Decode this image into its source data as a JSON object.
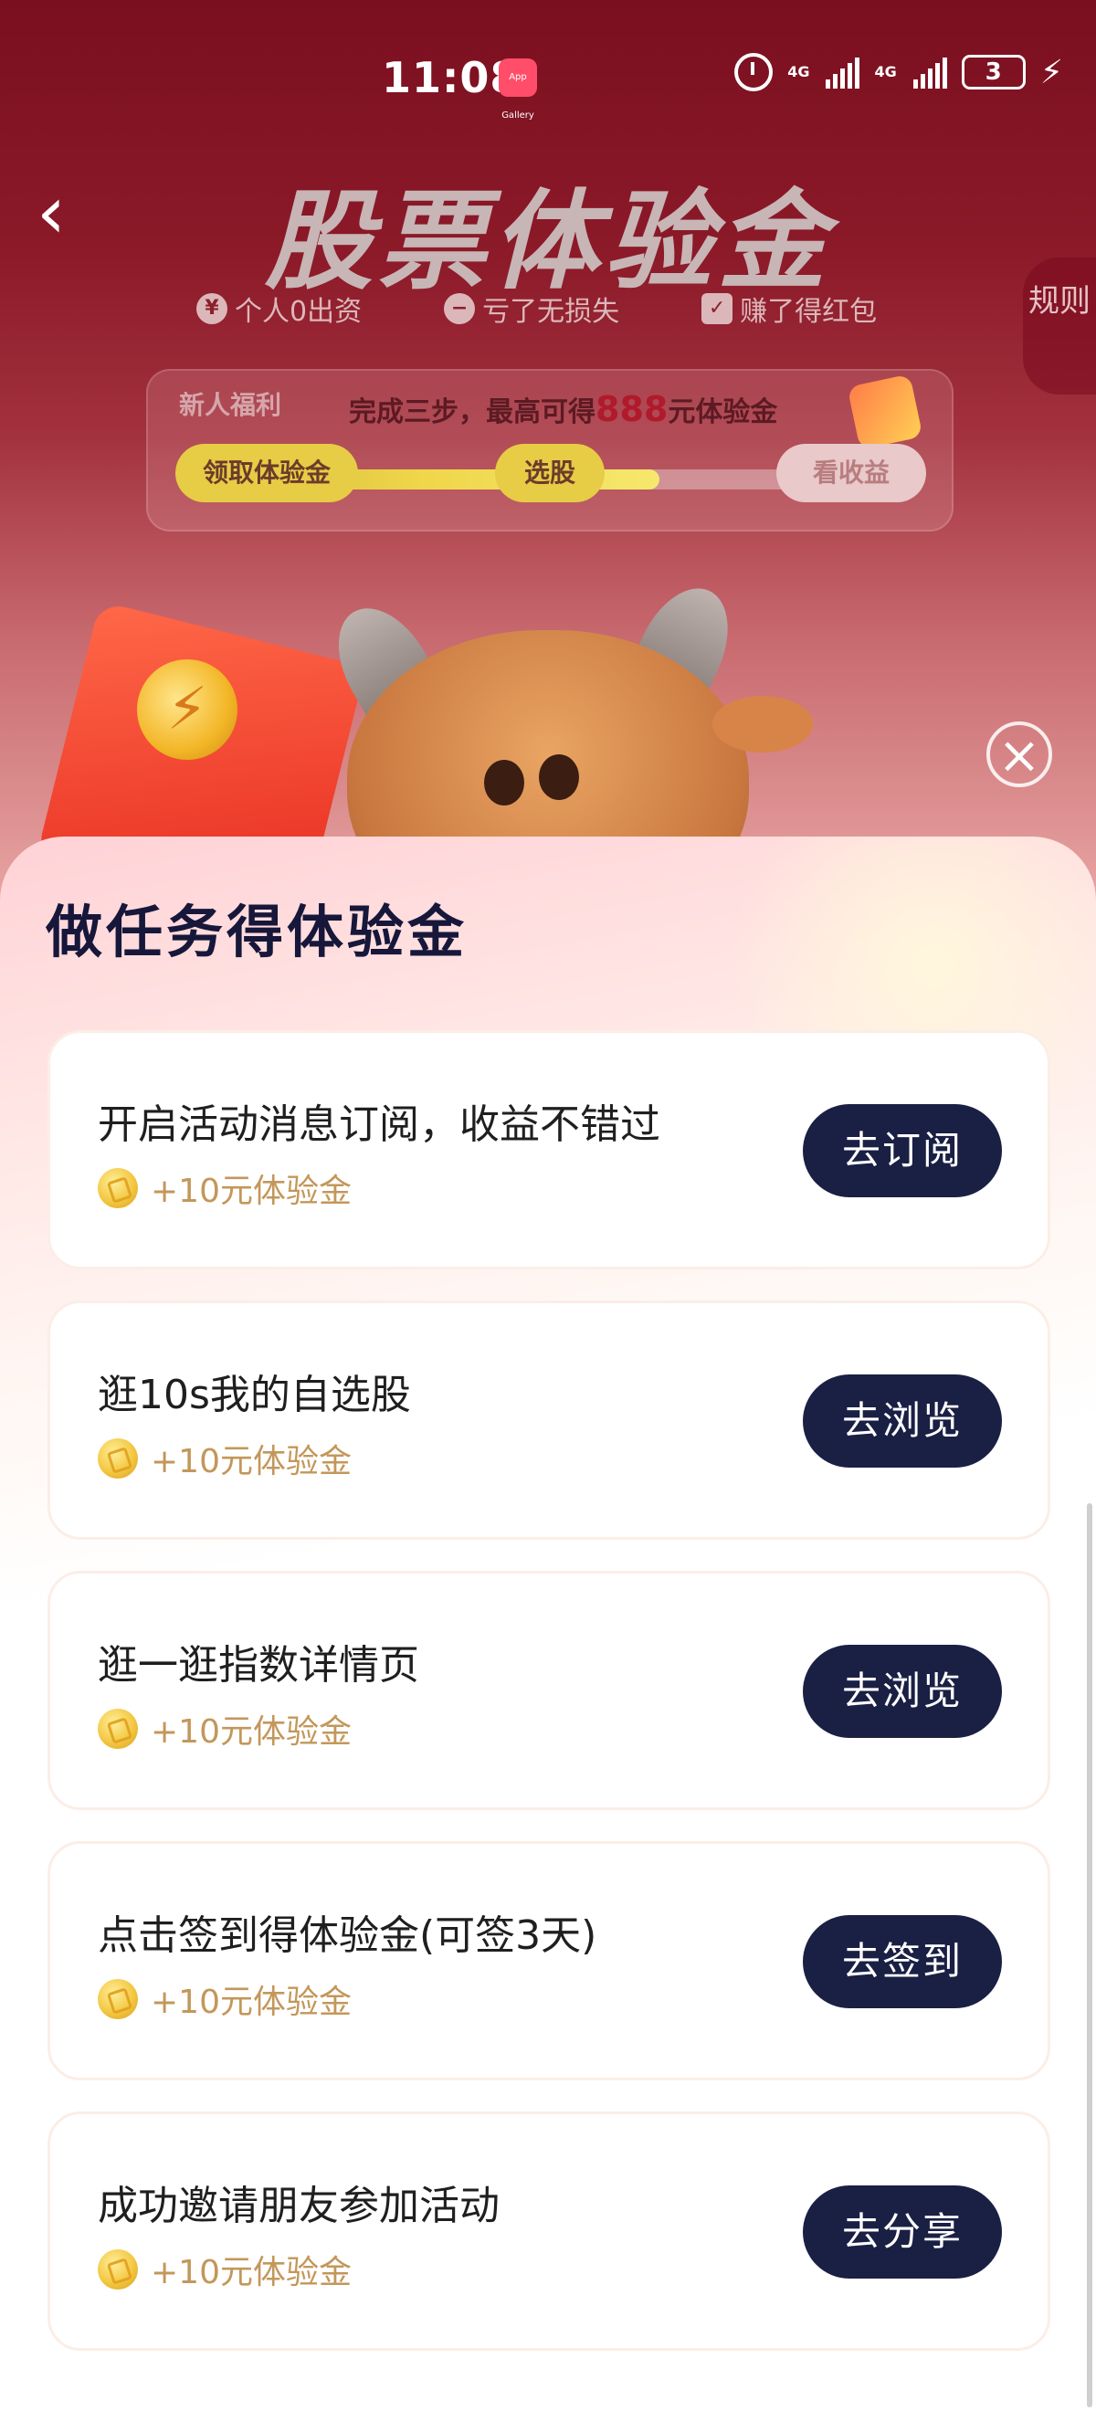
{
  "status_bar": {
    "time": "11:08",
    "app_icon_text": "App Gallery",
    "signal1_label": "4G",
    "signal2_label": "4G",
    "battery": "3"
  },
  "header": {
    "title": "股票体验金",
    "tags": [
      {
        "icon": "¥",
        "text": "个人0出资"
      },
      {
        "icon": "−",
        "text": "亏了无损失"
      },
      {
        "icon": "✓",
        "text": "赚了得红包"
      }
    ],
    "rules": "规则"
  },
  "progress": {
    "badge": "新人福利",
    "text_prefix": "完成三步，最高可得",
    "highlight": "888",
    "text_suffix": "元体验金",
    "steps": [
      "领取体验金",
      "选股",
      "看收益"
    ],
    "filled_fraction": 0.65
  },
  "sheet": {
    "title": "做任务得体验金",
    "tasks": [
      {
        "title": "开启活动消息订阅，收益不错过",
        "reward": "+10元体验金",
        "button": "去订阅"
      },
      {
        "title": "逛10s我的自选股",
        "reward": "+10元体验金",
        "button": "去浏览"
      },
      {
        "title": "逛一逛指数详情页",
        "reward": "+10元体验金",
        "button": "去浏览"
      },
      {
        "title": "点击签到得体验金(可签3天)",
        "reward": "+10元体验金",
        "button": "去签到"
      },
      {
        "title": "成功邀请朋友参加活动",
        "reward": "+10元体验金",
        "button": "去分享"
      }
    ]
  },
  "colors": {
    "primary_button": "#1a1f44",
    "reward_text": "#c3975a",
    "hero_top": "#7a0f1f"
  }
}
